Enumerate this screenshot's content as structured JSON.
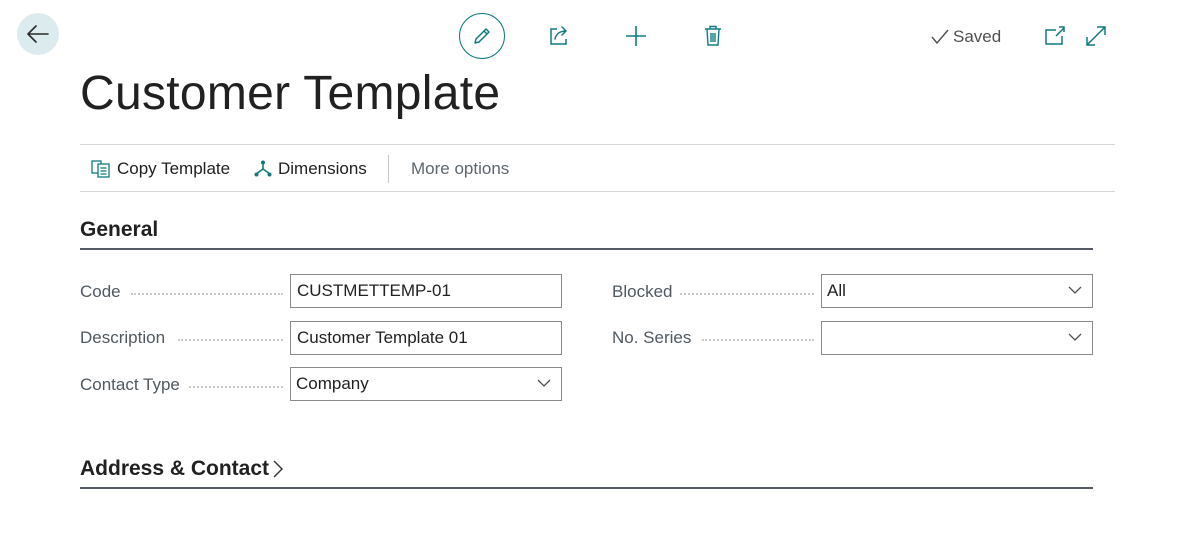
{
  "toolbar": {
    "back_icon": "arrow-left-icon",
    "edit_icon": "pencil-icon",
    "share_icon": "share-icon",
    "new_icon": "plus-icon",
    "delete_icon": "trash-icon",
    "saved_label": "Saved",
    "open_new_window_icon": "open-in-new-window-icon",
    "expand_icon": "expand-icon"
  },
  "page": {
    "title": "Customer Template"
  },
  "actions": {
    "copy_template": "Copy Template",
    "dimensions": "Dimensions",
    "more_options": "More options"
  },
  "general": {
    "heading": "General",
    "fields": {
      "code": {
        "label": "Code",
        "value": "CUSTMETTEMP-01"
      },
      "description": {
        "label": "Description",
        "value": "Customer Template 01"
      },
      "contact_type": {
        "label": "Contact Type",
        "value": "Company"
      },
      "blocked": {
        "label": "Blocked",
        "value": "All"
      },
      "no_series": {
        "label": "No. Series",
        "value": ""
      }
    }
  },
  "address_contact": {
    "heading": "Address & Contact"
  },
  "colors": {
    "accent": "#0f7b81",
    "back_bg": "#dcebed",
    "rule": "#545a66"
  }
}
